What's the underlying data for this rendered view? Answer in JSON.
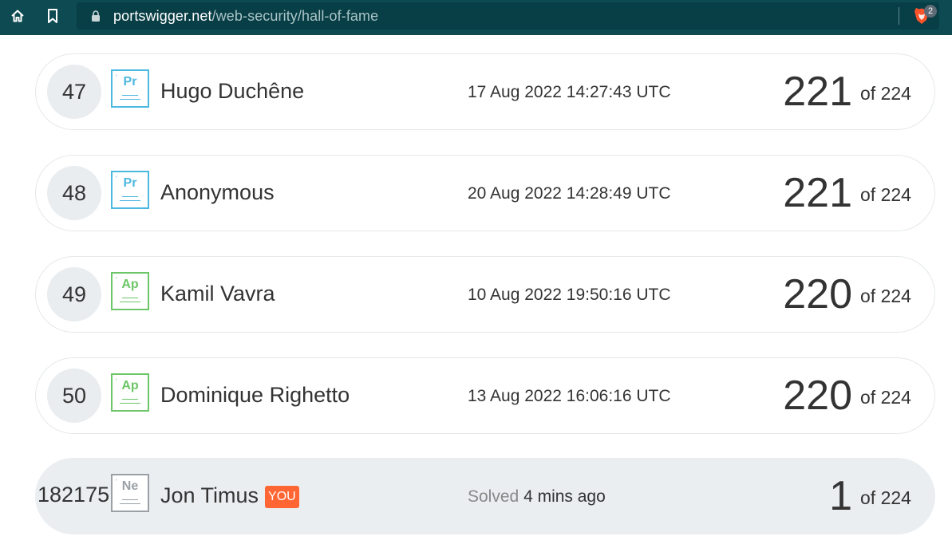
{
  "browser": {
    "url_host": "portswigger.net",
    "url_path": "/web-security/hall-of-fame",
    "extension_badge": "2"
  },
  "colors": {
    "browser_bar": "#0d4a52",
    "practitioner": "#4db8e0",
    "apprentice": "#6cc667",
    "newcomer": "#9aa0a6",
    "you_badge": "#ff6633"
  },
  "rows": [
    {
      "rank": "47",
      "badge": {
        "symbol": "Pr",
        "level": "practitioner"
      },
      "name": "Hugo Duchêne",
      "date": "17 Aug 2022 14:27:43 UTC",
      "score": "221",
      "of_total": "of 224"
    },
    {
      "rank": "48",
      "badge": {
        "symbol": "Pr",
        "level": "practitioner"
      },
      "name": "Anonymous",
      "date": "20 Aug 2022 14:28:49 UTC",
      "score": "221",
      "of_total": "of 224"
    },
    {
      "rank": "49",
      "badge": {
        "symbol": "Ap",
        "level": "apprentice"
      },
      "name": "Kamil Vavra",
      "date": "10 Aug 2022 19:50:16 UTC",
      "score": "220",
      "of_total": "of 224"
    },
    {
      "rank": "50",
      "badge": {
        "symbol": "Ap",
        "level": "apprentice"
      },
      "name": "Dominique Righetto",
      "date": "13 Aug 2022 16:06:16 UTC",
      "score": "220",
      "of_total": "of 224"
    }
  ],
  "me": {
    "rank": "182175",
    "badge": {
      "symbol": "Ne",
      "level": "newcomer"
    },
    "name": "Jon Timus",
    "you_label": "YOU",
    "solved_label": "Solved",
    "solved_time": "4 mins ago",
    "score": "1",
    "of_total": "of 224"
  }
}
